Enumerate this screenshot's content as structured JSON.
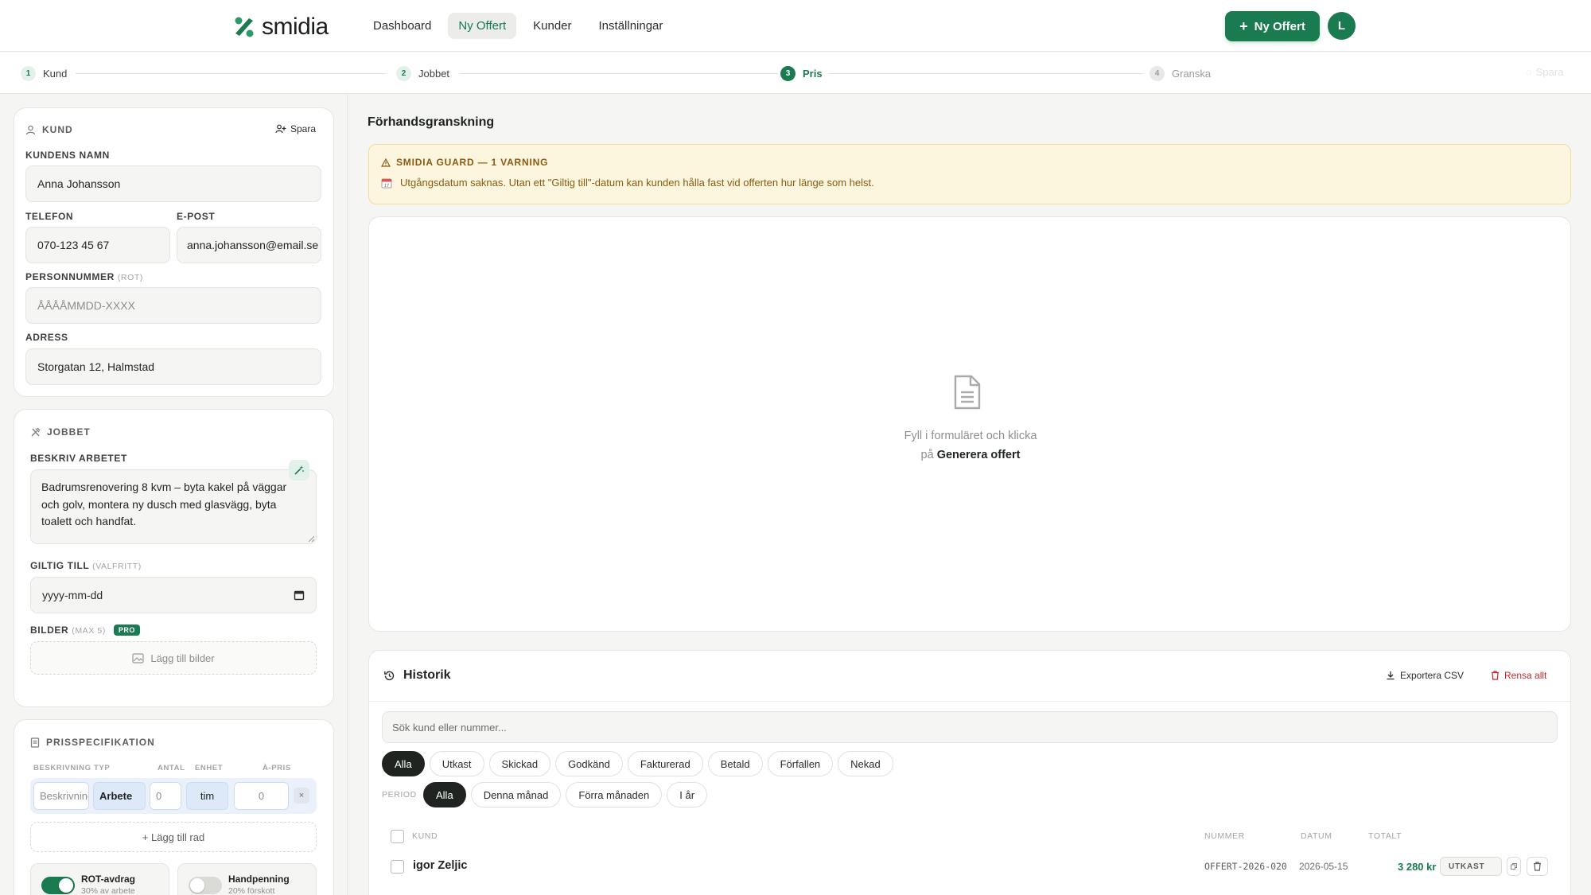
{
  "app": {
    "logo_text": "smidia",
    "brand_color": "#1a7a50"
  },
  "nav": {
    "items": [
      "Dashboard",
      "Ny Offert",
      "Kunder",
      "Inställningar"
    ],
    "active": "Ny Offert"
  },
  "header": {
    "new_button_label": "Ny Offert",
    "avatar_initial": "L"
  },
  "stepper": {
    "steps": [
      {
        "num": "1",
        "label": "Kund",
        "state": "done"
      },
      {
        "num": "2",
        "label": "Jobbet",
        "state": "done"
      },
      {
        "num": "3",
        "label": "Pris",
        "state": "current"
      },
      {
        "num": "4",
        "label": "Granska",
        "state": "todo"
      }
    ],
    "save_label": "Spara"
  },
  "kund": {
    "title": "KUND",
    "save_label": "Spara",
    "name_label": "KUNDENS NAMN",
    "name_value": "Anna Johansson",
    "phone_label": "TELEFON",
    "phone_value": "070-123 45 67",
    "email_label": "E-POST",
    "email_value": "anna.johansson@email.se",
    "pnr_label": "PERSONNUMMER",
    "pnr_hint": "(ROT)",
    "pnr_placeholder": "ÅÅÅÅMMDD-XXXX",
    "address_label": "ADRESS",
    "address_value": "Storgatan 12, Halmstad"
  },
  "jobbet": {
    "title": "JOBBET",
    "describe_label": "BESKRIV ARBETET",
    "description": "Badrumsrenovering 8 kvm – byta kakel på väggar och golv, montera ny dusch med glasvägg, byta toalett och handfat.",
    "valid_label": "GILTIG TILL",
    "valid_hint": "(VALFRITT)",
    "valid_placeholder": "yyyy-mm-dd",
    "images_label": "BILDER",
    "images_hint": "(MAX 5)",
    "pro_badge": "PRO",
    "add_images_label": "Lägg till bilder"
  },
  "pris": {
    "title": "PRISSPECIFIKATION",
    "columns": [
      "BESKRIVNING",
      "TYP",
      "ANTAL",
      "ENHET",
      "À-PRIS"
    ],
    "row": {
      "description_placeholder": "Beskrivning",
      "type": "Arbete",
      "quantity": "0",
      "unit": "tim",
      "unit_price": "0",
      "remove": "×"
    },
    "add_row_label": "+ Lägg till rad",
    "rot": {
      "title": "ROT-avdrag",
      "subtitle": "30% av arbete",
      "enabled": true
    },
    "deposit": {
      "title": "Handpenning",
      "subtitle": "20% förskott",
      "enabled": false
    }
  },
  "preview": {
    "title": "Förhandsgranskning",
    "guard_title": "SMIDIA GUARD — 1 VARNING",
    "guard_message": "Utgångsdatum saknas. Utan ett \"Giltig till\"-datum kan kunden hålla fast vid offerten hur länge som helst.",
    "empty_line1": "Fyll i formuläret och klicka",
    "empty_line2_prefix": "på",
    "empty_line2_bold": "Generera offert"
  },
  "historik": {
    "title": "Historik",
    "export_label": "Exportera CSV",
    "clear_label": "Rensa allt",
    "search_placeholder": "Sök kund eller nummer...",
    "status_filters": [
      "Alla",
      "Utkast",
      "Skickad",
      "Godkänd",
      "Fakturerad",
      "Betald",
      "Förfallen",
      "Nekad"
    ],
    "active_status": "Alla",
    "period_label": "PERIOD",
    "period_filters": [
      "Alla",
      "Denna månad",
      "Förra månaden",
      "I år"
    ],
    "active_period": "Alla",
    "columns": {
      "customer": "KUND",
      "number": "NUMMER",
      "date": "DATUM",
      "total": "TOTALT"
    },
    "rows": [
      {
        "customer": "igor Zeljic",
        "number": "OFFERT-2026-020",
        "date": "2026-05-15",
        "total": "3 280 kr",
        "status": "UTKAST"
      }
    ]
  }
}
